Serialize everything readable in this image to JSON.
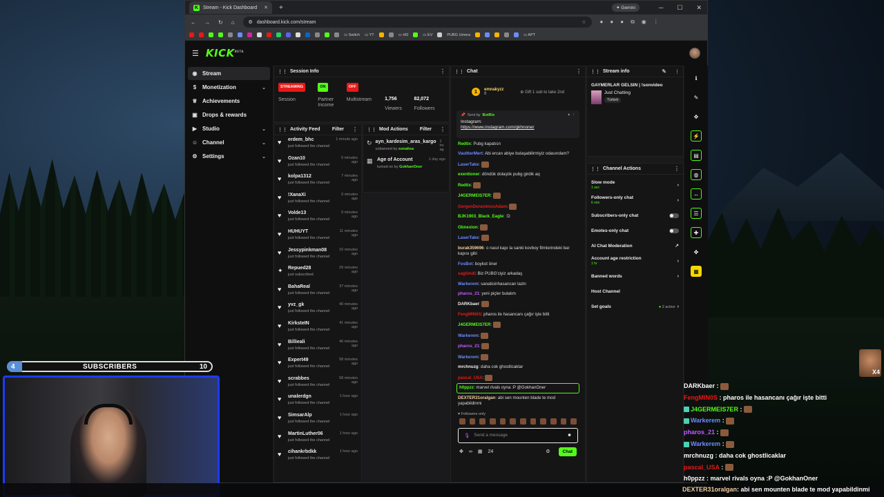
{
  "browser": {
    "tab_title": "Stream - Kick Dashboard",
    "url": "dashboard.kick.com/stream",
    "gemini_label": "Gemini",
    "bookmarks": [
      "Switch",
      "YT",
      "HD",
      "EV",
      "PUBG Umora",
      "APT"
    ]
  },
  "brand": {
    "logo": "KICK",
    "beta": "BETA",
    "accent": "#53fc18"
  },
  "sidebar": {
    "items": [
      {
        "label": "Stream",
        "icon": "broadcast-icon"
      },
      {
        "label": "Monetization",
        "icon": "dollar-icon"
      },
      {
        "label": "Achievements",
        "icon": "trophy-icon"
      },
      {
        "label": "Drops & rewards",
        "icon": "gift-icon"
      },
      {
        "label": "Studio",
        "icon": "camera-icon"
      },
      {
        "label": "Channel",
        "icon": "user-icon"
      },
      {
        "label": "Settings",
        "icon": "gear-icon"
      }
    ]
  },
  "session": {
    "title": "Session Info",
    "streaming": "STREAMING",
    "session": "Session",
    "on": "ON",
    "partner": "Partner",
    "income": "Income",
    "off": "OFF",
    "multistream": "Multistream",
    "viewers_value": "1,756",
    "viewers": "Viewers",
    "followers_value": "82,072",
    "followers": "Followers"
  },
  "activity": {
    "title": "Activity Feed",
    "filter": "Filter",
    "items": [
      {
        "name": "erdem_bhc",
        "sub": "just followed the channel",
        "time": "1 minute ago"
      },
      {
        "name": "Ozan10",
        "sub": "just followed the channel",
        "time": "5 minutes ago"
      },
      {
        "name": "kolpa1312",
        "sub": "just followed the channel",
        "time": "7 minutes ago"
      },
      {
        "name": "!XanaXi",
        "sub": "just followed the channel",
        "time": "9 minutes ago"
      },
      {
        "name": "Volde13",
        "sub": "just followed the channel",
        "time": "9 minutes ago"
      },
      {
        "name": "HUHUYT",
        "sub": "just followed the channel",
        "time": "11 minutes ago"
      },
      {
        "name": "Jessypinkman08",
        "sub": "just followed the channel",
        "time": "16 minutes ago"
      },
      {
        "name": "Repued28",
        "sub": "just subscribed",
        "time": "29 minutes ago"
      },
      {
        "name": "BahaReal",
        "sub": "just followed the channel",
        "time": "37 minutes ago"
      },
      {
        "name": "yvz_gk",
        "sub": "just followed the channel",
        "time": "40 minutes ago"
      },
      {
        "name": "KirksteIN",
        "sub": "just followed the channel",
        "time": "41 minutes ago"
      },
      {
        "name": "Billieali",
        "sub": "just followed the channel",
        "time": "46 minutes ago"
      },
      {
        "name": "Expert49",
        "sub": "just followed the channel",
        "time": "58 minutes ago"
      },
      {
        "name": "scrabbes",
        "sub": "just followed the channel",
        "time": "58 minutes ago"
      },
      {
        "name": "unalerdgn",
        "sub": "just followed the channel",
        "time": "1 hour ago"
      },
      {
        "name": "SimsarAlp",
        "sub": "just followed the channel",
        "time": "1 hour ago"
      },
      {
        "name": "MartinLuther06",
        "sub": "just followed the channel",
        "time": "1 hour ago"
      },
      {
        "name": "cihankrbdkk",
        "sub": "just followed the channel",
        "time": "1 hour ago"
      }
    ]
  },
  "mod": {
    "title": "Mod Actions",
    "filter": "Filter",
    "items": [
      {
        "name": "ayn_kardesim_aras_kargo",
        "prefix": "unbanned by",
        "by": "sonalisa",
        "time": "1 ho ag"
      },
      {
        "name": "Age of Account",
        "prefix": "turned on by",
        "by": "GokhanOner",
        "time": "1 day ago"
      }
    ]
  },
  "chat": {
    "title": "Chat",
    "gift_user": "emnakyzz",
    "gift_count": "8",
    "gift_text": "Gift 1 sub to take 2nd",
    "pinned_by_label": "Sent by",
    "pinned_by": "BotRix",
    "pinned_line1": "Instagram:",
    "pinned_link": "https://www.instagram.com/gkhnoner",
    "messages": [
      {
        "user": "Redtix",
        "color": "#53fc18",
        "text": "Pubg kapatısn"
      },
      {
        "user": "VaultterMert",
        "color": "#6a8cff",
        "text": "Abi ercan abiye bulaşabilirmiyiz odasındam?"
      },
      {
        "user": "LaserTake",
        "color": "#6a8cff",
        "text": ""
      },
      {
        "user": "exentioner",
        "color": "#53fc18",
        "text": "döndük dolaştık pubg girdik aq"
      },
      {
        "user": "Redtix",
        "color": "#53fc18",
        "text": ""
      },
      {
        "user": "J4GERMEIS7ER",
        "color": "#53fc18",
        "text": ""
      },
      {
        "user": "GergenDeranimusAdam",
        "color": "#e91916",
        "text": ""
      },
      {
        "user": "BJK1903_Black_Eagle",
        "color": "#53fc18",
        "text": ":D"
      },
      {
        "user": "Obnexion",
        "color": "#53fc18",
        "text": ""
      },
      {
        "user": "LaserTake",
        "color": "#6a8cff",
        "text": ""
      },
      {
        "user": "burak359696",
        "color": "#f2d0a0",
        "text": "o nasıl kapı la sanki kovboy filmlerindeki bar kapısı gibi"
      },
      {
        "user": "FosBot",
        "color": "#6a8cff",
        "text": "boykot öner"
      },
      {
        "user": "saglimdi",
        "color": "#e91916",
        "text": "Biz PUBG'ciyiz arkadaş"
      },
      {
        "user": "Warkerem",
        "color": "#6a8cff",
        "text": "sanaticinhasancan lazin"
      },
      {
        "user": "pharos_21",
        "color": "#c05bff",
        "text": "yeni piçler bulalım"
      },
      {
        "user": "DARKbaer",
        "color": "#eee",
        "text": ""
      },
      {
        "user": "FengMIN0S",
        "color": "#e91916",
        "text": "pharos ile hasancanı çağır işte bitti"
      },
      {
        "user": "J4GERMEIS7ER",
        "color": "#53fc18",
        "text": ""
      },
      {
        "user": "Warkerem",
        "color": "#6a8cff",
        "text": ""
      },
      {
        "user": "pharos_21",
        "color": "#c05bff",
        "text": ""
      },
      {
        "user": "Warkerem",
        "color": "#6a8cff",
        "text": ""
      },
      {
        "user": "mrchnuzg",
        "color": "#eee",
        "text": "daha cok ghostlicaklar"
      },
      {
        "user": "pascal_USA",
        "color": "#e91916",
        "text": ""
      },
      {
        "user": "h0ppzz",
        "color": "#53fc18",
        "text": "marvel rivals oyna :P @GokhanOner"
      },
      {
        "user": "DEXTER31oralgan",
        "color": "#f2d0a0",
        "text": "abi sen mounten blade te mod yapabildinmi"
      }
    ],
    "followers_only": "Followers only",
    "placeholder": "Send a message",
    "count": "24",
    "send": "Chat"
  },
  "stream_info": {
    "title": "Stream info",
    "stream_title": "GAYMERLAR GELSIN | !sonvideo",
    "category": "Just Chatting",
    "tag": "Türkish"
  },
  "channel_actions": {
    "title": "Channel Actions",
    "items": [
      {
        "label": "Slow mode",
        "sub": "1 sec",
        "ctl": "chev"
      },
      {
        "label": "Followers-only chat",
        "sub": "6 min",
        "ctl": "chev"
      },
      {
        "label": "Subscribers-only chat",
        "sub": "",
        "ctl": "toggle"
      },
      {
        "label": "Emotes-only chat",
        "sub": "",
        "ctl": "toggle"
      },
      {
        "label": "AI Chat Moderation",
        "sub": "",
        "ctl": "ext"
      },
      {
        "label": "Account age restriction",
        "sub": "1 hr",
        "ctl": "chev"
      },
      {
        "label": "Banned words",
        "sub": "",
        "ctl": "chev"
      },
      {
        "label": "Host Channel",
        "sub": "",
        "ctl": "none"
      },
      {
        "label": "Set goals",
        "sub": "",
        "ctl": "goals"
      }
    ],
    "goals_active": "2 active"
  },
  "overlay": {
    "sub_left": "4",
    "sub_label": "SUBSCRIBERS",
    "sub_right": "10",
    "x4": "X4",
    "chat": [
      {
        "user": "DARKbaer",
        "color": "#ffffff",
        "text": ":"
      },
      {
        "user": "FengMIN0S",
        "color": "#e91916",
        "text": ": pharos ile hasancanı çağır işte bitti"
      },
      {
        "user": "J4GERMEIS7ER",
        "color": "#53fc18",
        "text": ":"
      },
      {
        "user": "Warkerem",
        "color": "#6a8cff",
        "text": ":"
      },
      {
        "user": "pharos_21",
        "color": "#c05bff",
        "text": ":"
      },
      {
        "user": "Warkerem",
        "color": "#6a8cff",
        "text": ":"
      },
      {
        "user": "mrchnuzg",
        "color": "#ffffff",
        "text": ": daha cok ghostlicaklar"
      },
      {
        "user": "pascal_USA",
        "color": "#e91916",
        "text": ":"
      },
      {
        "user": "h0ppzz",
        "color": "#ffffff",
        "text": ": marvel rivals oyna :P @GokhanOner"
      }
    ],
    "last_user": "DEXTER31oralgan",
    "last_text": ": abi sen mounten blade te mod yapabildinmi"
  }
}
